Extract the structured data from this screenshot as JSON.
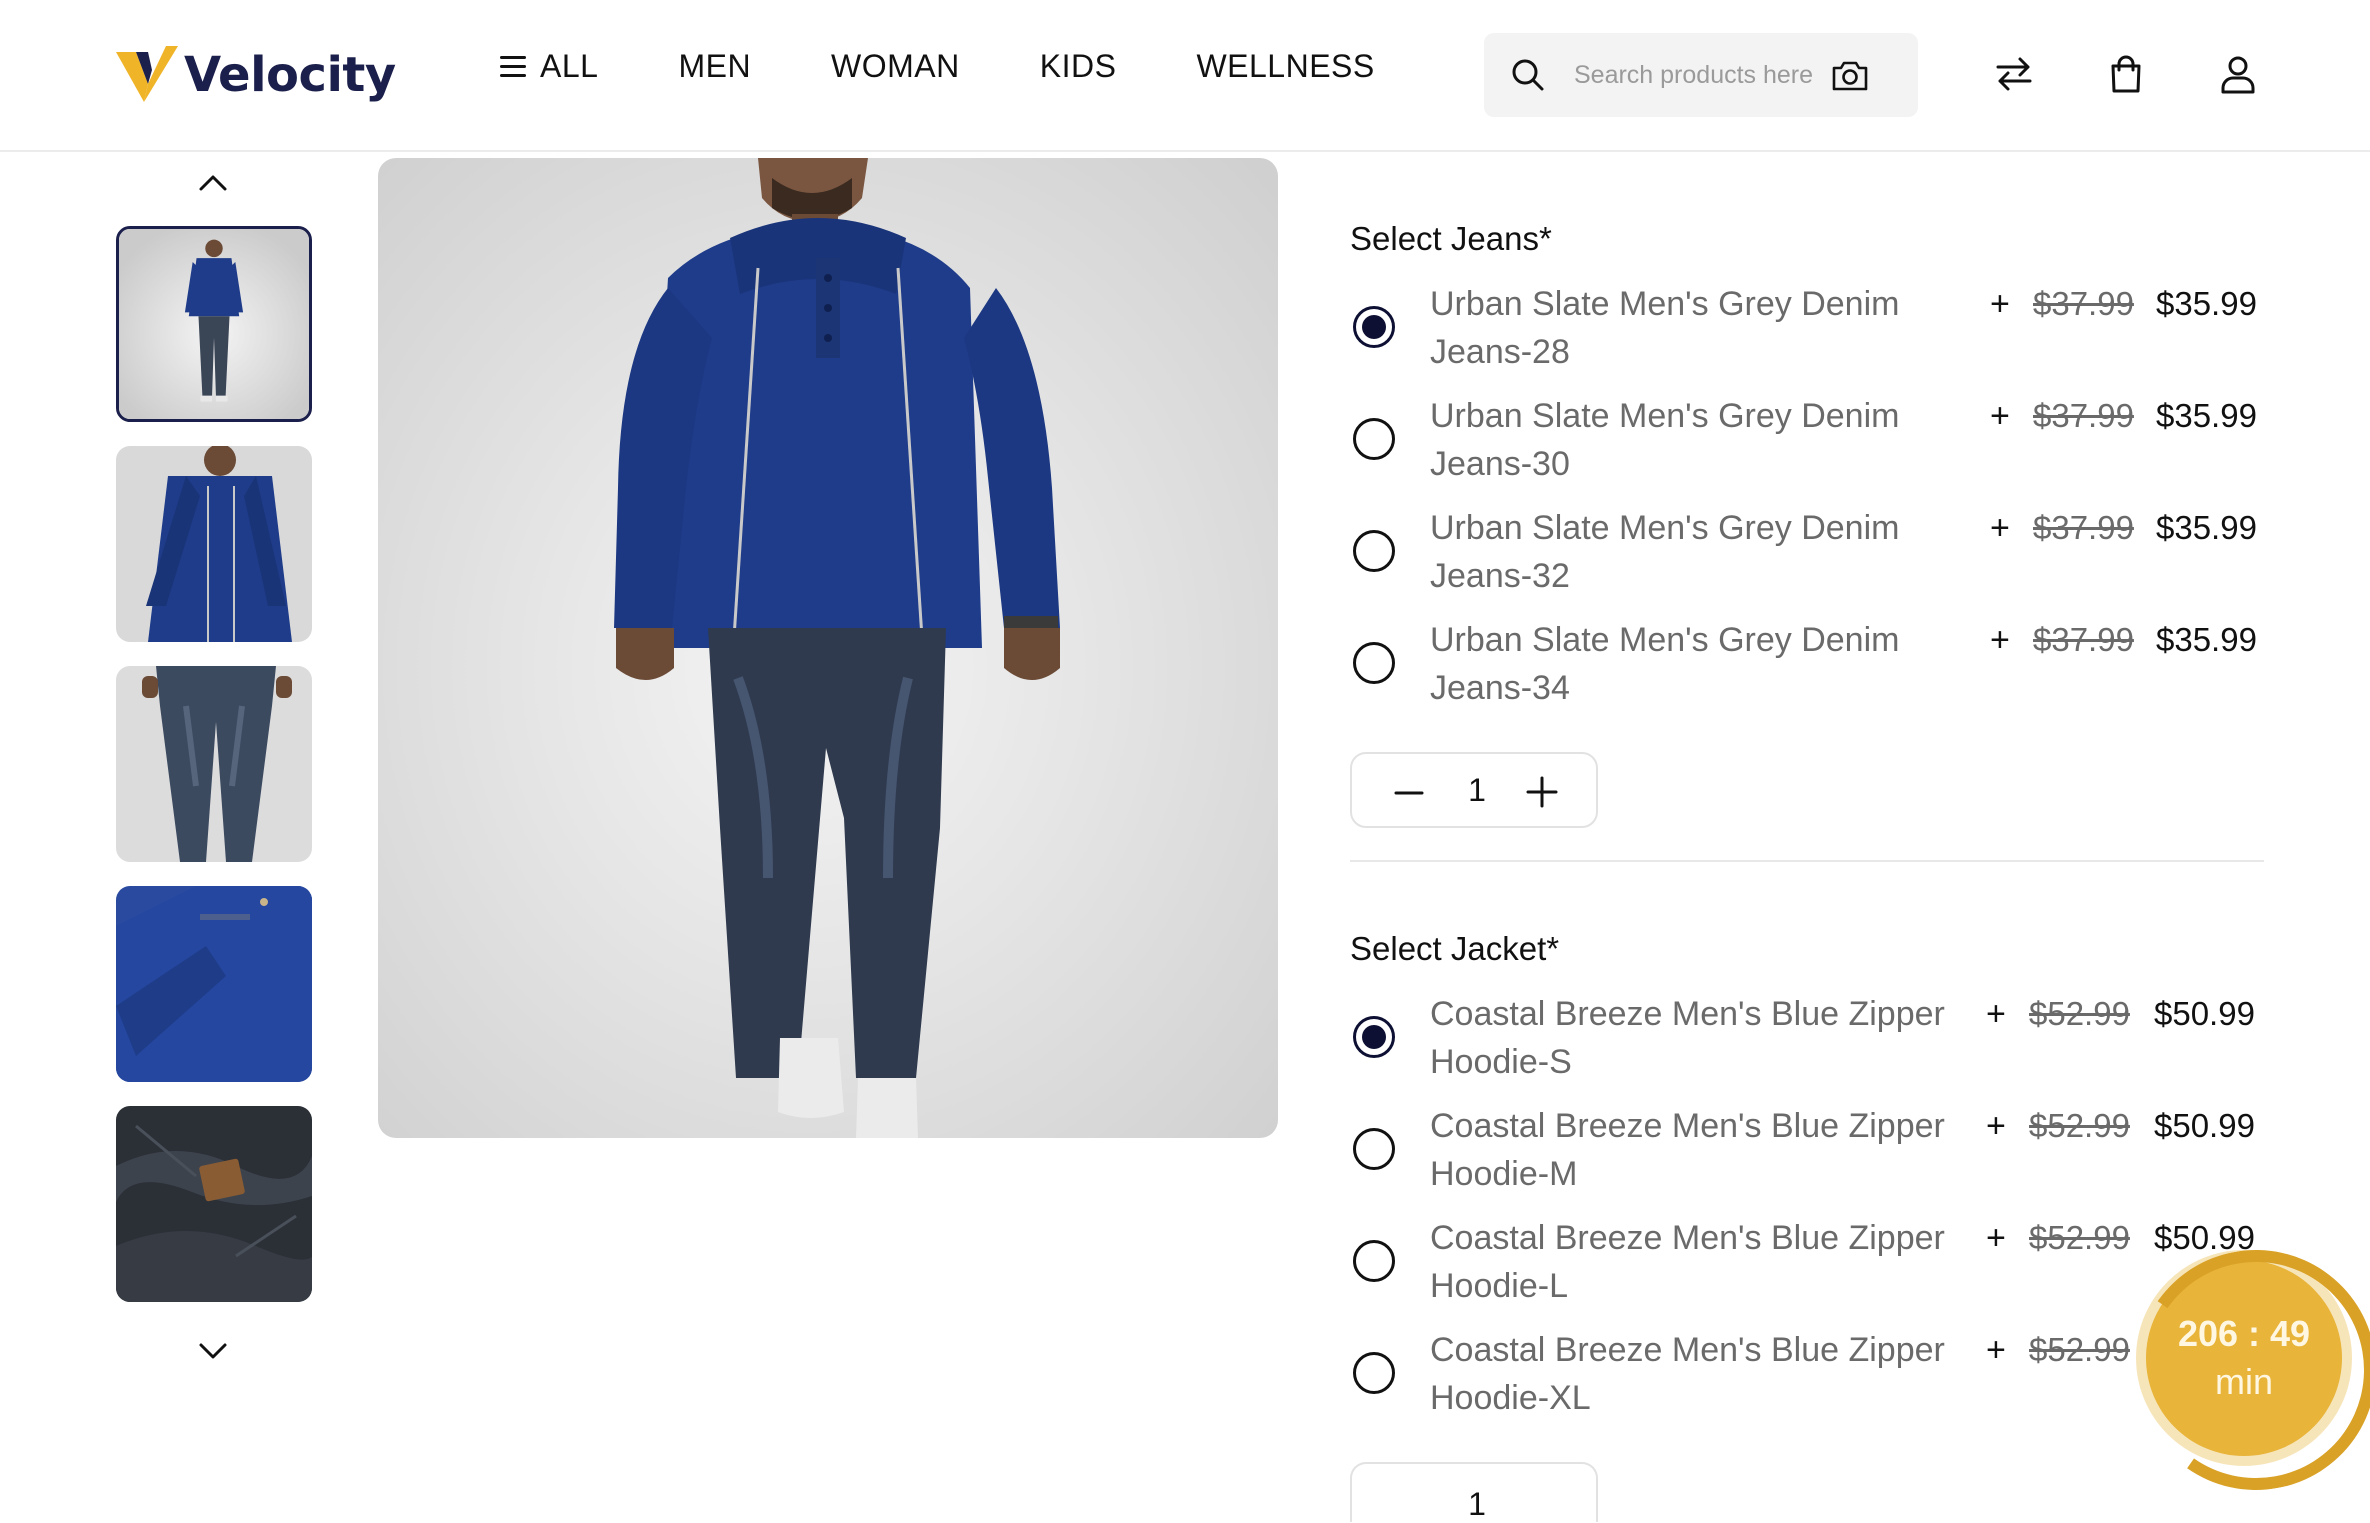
{
  "brand": {
    "name": "Velocity",
    "colors": {
      "navy": "#1b1f4b",
      "gold": "#f0b429",
      "timer": "#e8b43a"
    }
  },
  "nav": {
    "all_label": "ALL",
    "men_label": "MEN",
    "woman_label": "WOMAN",
    "kids_label": "KIDS",
    "wellness_label": "WELLNESS"
  },
  "search": {
    "placeholder": "Search products here"
  },
  "header_icons": [
    "search-icon",
    "camera-icon",
    "compare-arrows-icon",
    "shopping-bag-icon",
    "user-icon"
  ],
  "thumbnails": [
    {
      "label": "full-outfit",
      "selected": true
    },
    {
      "label": "hoodie-closeup",
      "selected": false
    },
    {
      "label": "jeans-closeup",
      "selected": false
    },
    {
      "label": "hoodie-sleeve-detail",
      "selected": false
    },
    {
      "label": "denim-texture",
      "selected": false
    }
  ],
  "jeans": {
    "title": "Select Jeans*",
    "options": [
      {
        "name": "Urban Slate Men's Grey Denim Jeans-28",
        "plus": "+",
        "old_price": "$37.99",
        "price": "$35.99",
        "selected": true
      },
      {
        "name": "Urban Slate Men's Grey Denim Jeans-30",
        "plus": "+",
        "old_price": "$37.99",
        "price": "$35.99",
        "selected": false
      },
      {
        "name": "Urban Slate Men's Grey Denim Jeans-32",
        "plus": "+",
        "old_price": "$37.99",
        "price": "$35.99",
        "selected": false
      },
      {
        "name": "Urban Slate Men's Grey Denim Jeans-34",
        "plus": "+",
        "old_price": "$37.99",
        "price": "$35.99",
        "selected": false
      }
    ],
    "quantity": "1"
  },
  "jacket": {
    "title": "Select Jacket*",
    "options": [
      {
        "name": "Coastal Breeze Men's Blue Zipper Hoodie-S",
        "plus": "+",
        "old_price": "$52.99",
        "price": "$50.99",
        "selected": true
      },
      {
        "name": "Coastal Breeze Men's Blue Zipper Hoodie-M",
        "plus": "+",
        "old_price": "$52.99",
        "price": "$50.99",
        "selected": false
      },
      {
        "name": "Coastal Breeze Men's Blue Zipper Hoodie-L",
        "plus": "+",
        "old_price": "$52.99",
        "price": "$50.99",
        "selected": false
      },
      {
        "name": "Coastal Breeze Men's Blue Zipper Hoodie-XL",
        "plus": "+",
        "old_price": "$52.99",
        "price": "",
        "selected": false
      }
    ],
    "quantity": "1"
  },
  "timer": {
    "time": "206 : 49",
    "unit": "min"
  }
}
